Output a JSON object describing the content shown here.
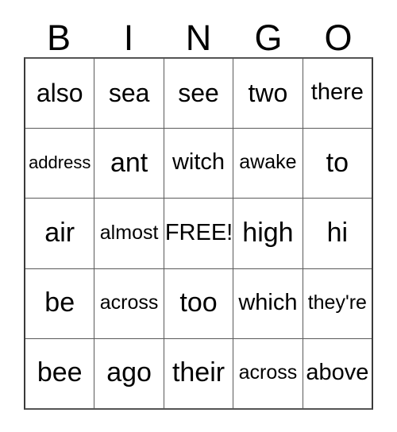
{
  "card": {
    "title": "BINGO",
    "header_letters": [
      "B",
      "I",
      "N",
      "G",
      "O"
    ],
    "free_space_label": "FREE!",
    "free_space_position": {
      "row": 3,
      "column": 3
    },
    "grid_size": "5x5",
    "colors": {
      "background": "#ffffff",
      "text": "#000000",
      "grid_line": "#5a5a5a",
      "grid_outer_border": "#3a3a3a"
    },
    "rows": [
      {
        "cells": [
          {
            "word": "also",
            "size": "lg"
          },
          {
            "word": "sea",
            "size": "lg"
          },
          {
            "word": "see",
            "size": "lg"
          },
          {
            "word": "two",
            "size": "lg"
          },
          {
            "word": "there",
            "size": "md"
          }
        ]
      },
      {
        "cells": [
          {
            "word": "address",
            "size": "xs"
          },
          {
            "word": "ant",
            "size": "xl"
          },
          {
            "word": "witch",
            "size": "md"
          },
          {
            "word": "awake",
            "size": "sm"
          },
          {
            "word": "to",
            "size": "xl"
          }
        ]
      },
      {
        "cells": [
          {
            "word": "air",
            "size": "xl"
          },
          {
            "word": "almost",
            "size": "sm"
          },
          {
            "word": "FREE!",
            "size": "md"
          },
          {
            "word": "high",
            "size": "xl"
          },
          {
            "word": "hi",
            "size": "xl"
          }
        ]
      },
      {
        "cells": [
          {
            "word": "be",
            "size": "xl"
          },
          {
            "word": "across",
            "size": "sm"
          },
          {
            "word": "too",
            "size": "xl"
          },
          {
            "word": "which",
            "size": "md"
          },
          {
            "word": "they're",
            "size": "sm"
          }
        ]
      },
      {
        "cells": [
          {
            "word": "bee",
            "size": "xl"
          },
          {
            "word": "ago",
            "size": "xl"
          },
          {
            "word": "their",
            "size": "xl"
          },
          {
            "word": "across",
            "size": "sm"
          },
          {
            "word": "above",
            "size": "md"
          }
        ]
      }
    ]
  }
}
